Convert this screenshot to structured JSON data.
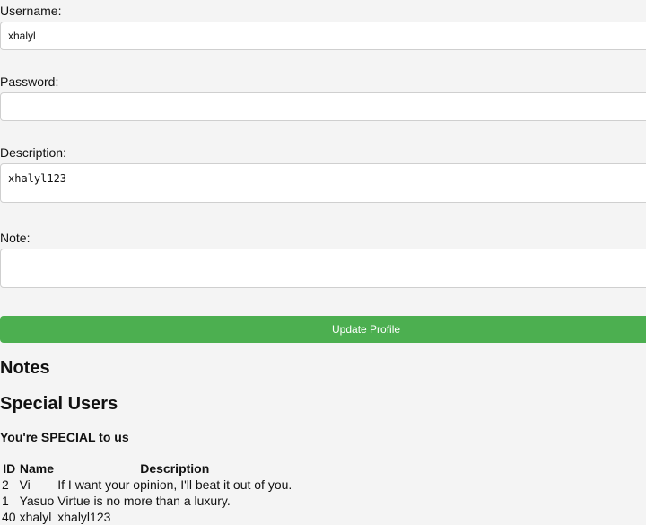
{
  "form": {
    "username_label": "Username:",
    "username_value": "xhalyl",
    "password_label": "Password:",
    "password_value": "",
    "description_label": "Description:",
    "description_value": "xhalyl123",
    "note_label": "Note:",
    "note_value": "",
    "submit_label": "Update Profile"
  },
  "notes": {
    "heading": "Notes"
  },
  "special_users": {
    "heading": "Special Users",
    "subheading": "You're SPECIAL to us",
    "columns": [
      "ID",
      "Name",
      "Description"
    ],
    "rows": [
      [
        "2",
        "Vi",
        "If I want your opinion, I'll beat it out of you."
      ],
      [
        "1",
        "Yasuo",
        "Virtue is no more than a luxury."
      ],
      [
        "40",
        "xhalyl",
        "xhalyl123"
      ]
    ]
  },
  "colors": {
    "button_green": "#4caf50",
    "background": "#f4f4f4"
  }
}
